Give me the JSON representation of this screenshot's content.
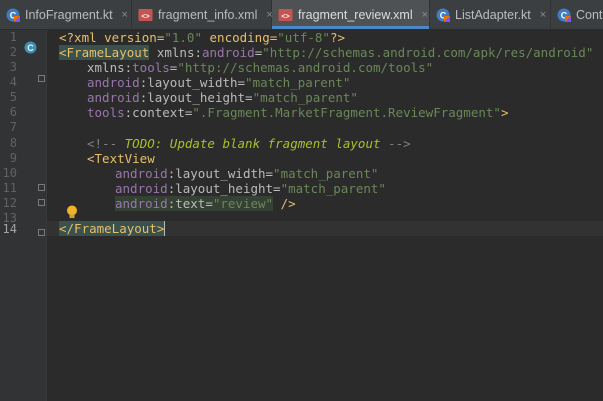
{
  "tabs": [
    {
      "label": "InfoFragment.kt",
      "kind": "kotlin"
    },
    {
      "label": "fragment_info.xml",
      "kind": "xml"
    },
    {
      "label": "fragment_review.xml",
      "kind": "xml",
      "active": true
    },
    {
      "label": "ListAdapter.kt",
      "kind": "kotlin"
    },
    {
      "label": "Cont",
      "kind": "kotlin"
    }
  ],
  "tab_close_symbol": "×",
  "line_numbers": [
    "1",
    "2",
    "3",
    "4",
    "5",
    "6",
    "7",
    "8",
    "9",
    "10",
    "11",
    "12",
    "13",
    "14"
  ],
  "code": {
    "l1": {
      "a": "<?xml version=",
      "b": "\"1.0\"",
      "c": " encoding=",
      "d": "\"utf-8\"",
      "e": "?>"
    },
    "l2": {
      "a": "<FrameLayout",
      "b": " xmlns:",
      "c": "android",
      "d": "=",
      "e": "\"http://schemas.android.com/apk/res/android\""
    },
    "l3": {
      "a": "xmlns:",
      "b": "tools",
      "c": "=",
      "d": "\"http://schemas.android.com/tools\""
    },
    "l4": {
      "a": "android",
      "b": ":layout_width=",
      "c": "\"match_parent\""
    },
    "l5": {
      "a": "android",
      "b": ":layout_height=",
      "c": "\"match_parent\""
    },
    "l6": {
      "a": "tools",
      "b": ":context=",
      "c": "\".Fragment.MarketFragment.ReviewFragment\"",
      "d": ">"
    },
    "l8": {
      "a": "<!-- ",
      "b": "TODO: Update blank fragment layout",
      "c": " -->"
    },
    "l9": {
      "a": "<TextView"
    },
    "l10": {
      "a": "android",
      "b": ":layout_width=",
      "c": "\"match_parent\""
    },
    "l11": {
      "a": "android",
      "b": ":layout_height=",
      "c": "\"match_parent\""
    },
    "l12": {
      "a": "android",
      "b": ":text=",
      "c": "\"review\"",
      "d": " />"
    },
    "l14": {
      "a": "</FrameLayout>"
    }
  },
  "icons": {
    "tab_kotlin": "kotlin-file-icon",
    "tab_xml": "xml-file-icon",
    "gutter_class": "class-gutter-icon",
    "intention": "lightbulb-icon"
  },
  "colors": {
    "background": "#2b2b2b",
    "tag": "#e8bf6a",
    "string": "#6a8759",
    "namespace": "#9876aa",
    "accent": "#4a88c7"
  }
}
